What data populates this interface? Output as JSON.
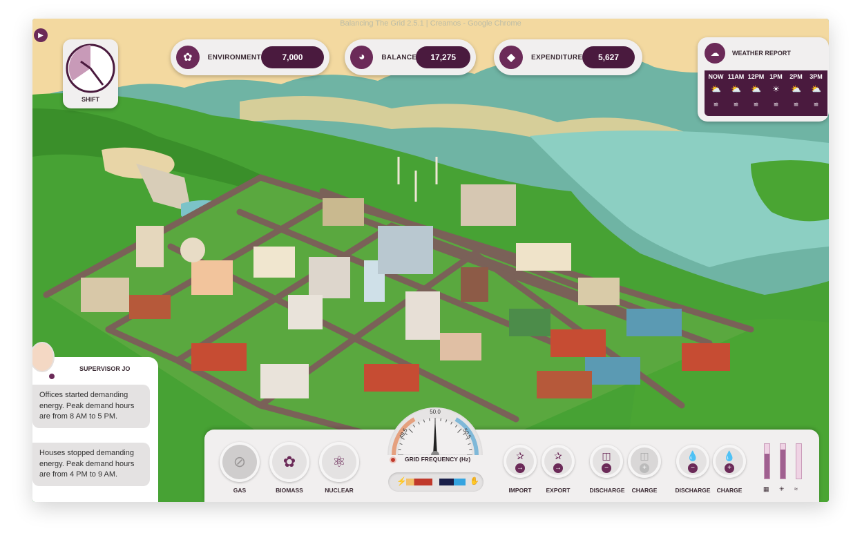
{
  "window_title": "Balancing The Grid 2.5.1 | Creamos - Google Chrome",
  "stats": [
    {
      "label": "ENVIRONMENT",
      "value": "7,000",
      "icon": "leaf-icon"
    },
    {
      "label": "BALANCE",
      "value": "17,275",
      "icon": "gauge-icon"
    },
    {
      "label": "EXPENDITURE",
      "value": "5,627",
      "icon": "diamond-icon"
    }
  ],
  "clock": {
    "label": "SHIFT"
  },
  "weather": {
    "title": "WEATHER REPORT",
    "hours": [
      {
        "time": "NOW",
        "icon": "partly-cloudy-icon"
      },
      {
        "time": "11AM",
        "icon": "partly-cloudy-icon"
      },
      {
        "time": "12PM",
        "icon": "partly-cloudy-icon"
      },
      {
        "time": "1PM",
        "icon": "sun-icon"
      },
      {
        "time": "2PM",
        "icon": "partly-cloudy-icon"
      },
      {
        "time": "3PM",
        "icon": "partly-cloudy-icon"
      }
    ]
  },
  "supervisor": {
    "name": "SUPERVISOR JO",
    "messages": [
      "Offices started demanding energy. Peak demand hours are from 8 AM to 5 PM.",
      "Houses stopped demanding energy. Peak demand hours are from 4 PM to 9 AM."
    ]
  },
  "gauge": {
    "value": 50.0,
    "min": 49.5,
    "max": 50.5,
    "center_label": "50.0",
    "min_label": "49.5",
    "max_label": "50.5"
  },
  "frequency_label": "GRID FREQUENCY (Hz)",
  "controls": {
    "gas": "GAS",
    "biomass": "BIOMASS",
    "nuclear": "NUCLEAR",
    "import": "IMPORT",
    "export": "EXPORT",
    "battery_discharge": "DISCHARGE",
    "battery_charge": "CHARGE",
    "hydro_discharge": "DISCHARGE",
    "hydro_charge": "CHARGE"
  },
  "levels": {
    "solar": 0.72,
    "wind": 0.85,
    "hydro": 0.0
  },
  "colors": {
    "accent": "#6b2a58",
    "dark": "#4a1a3e",
    "panel": "#f1efef"
  }
}
